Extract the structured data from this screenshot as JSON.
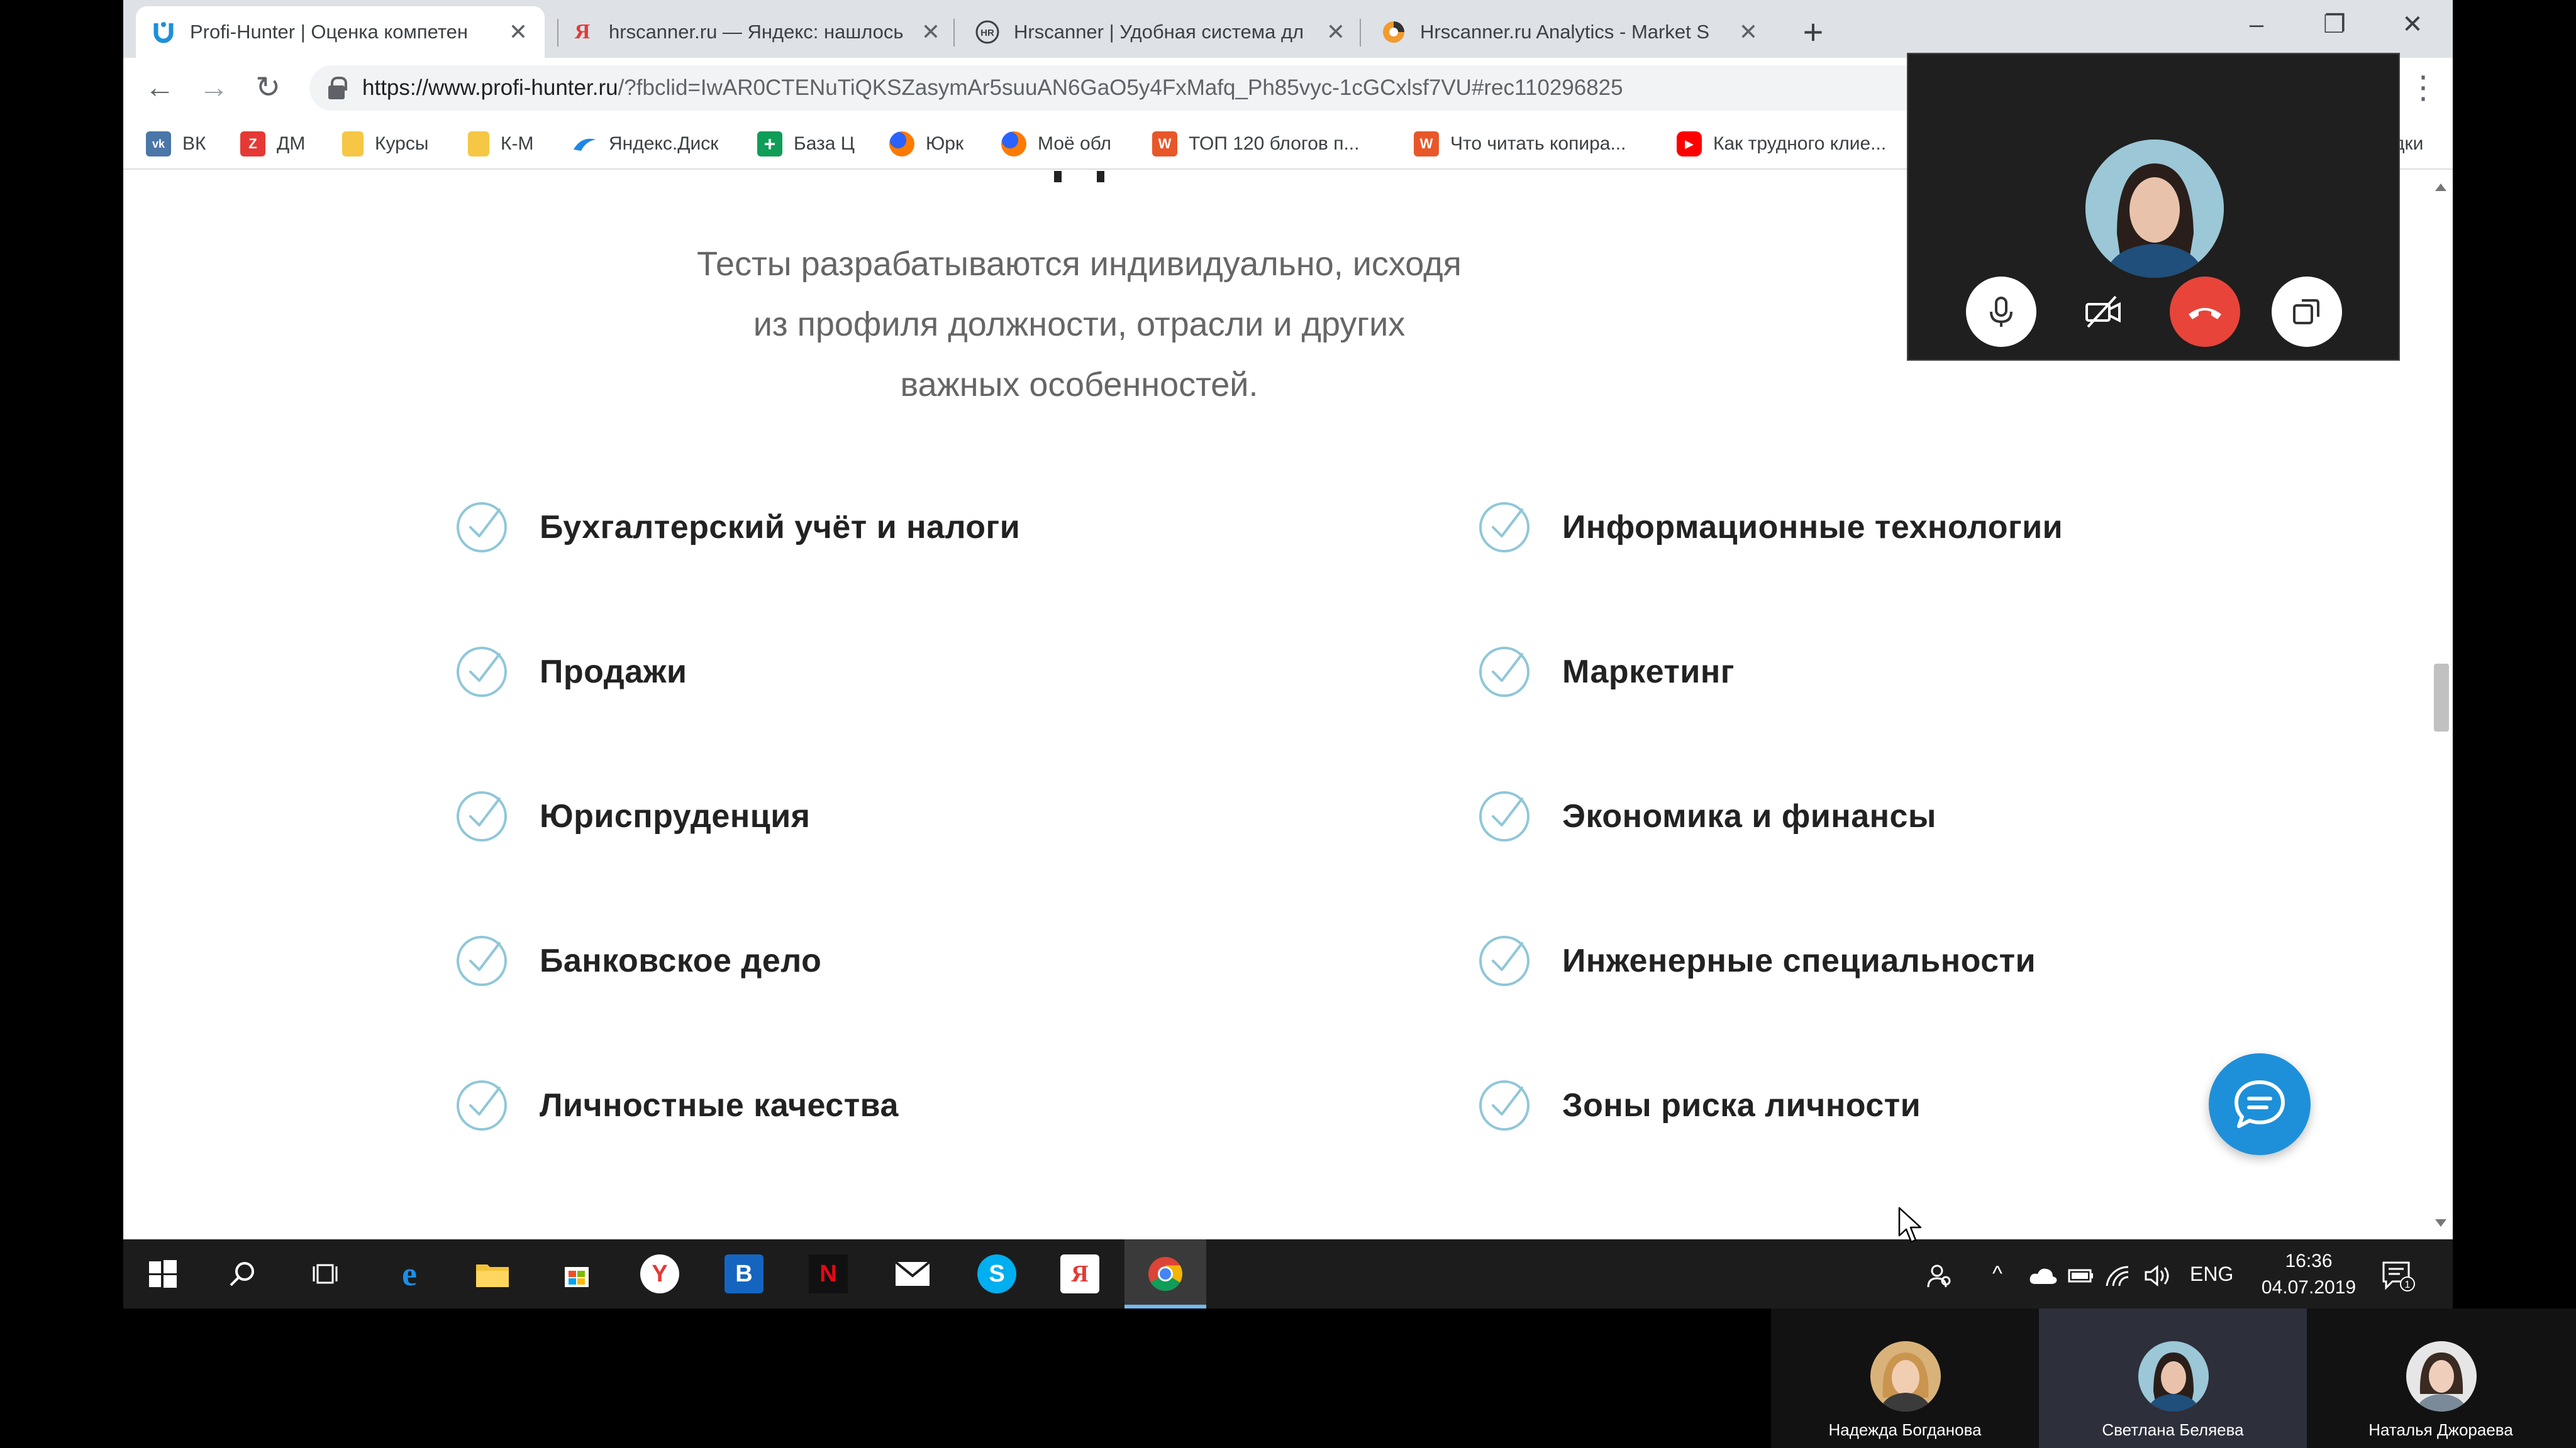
{
  "browser": {
    "tabs": [
      {
        "title": "Profi-Hunter | Оценка компетен",
        "favicon": "profi-hunter-logo",
        "active": true
      },
      {
        "title": "hrscanner.ru — Яндекс: нашлось",
        "favicon": "yandex-logo",
        "active": false
      },
      {
        "title": "Hrscanner | Удобная система дл",
        "favicon": "hr-logo",
        "active": false
      },
      {
        "title": "Hrscanner.ru Analytics - Market S",
        "favicon": "analytics-logo",
        "active": false
      }
    ],
    "tab_close_glyph": "✕",
    "new_tab_glyph": "+",
    "url_host": "https://www.profi-hunter.ru",
    "url_path": "/?fbclid=IwAR0CTENuTiQKSZasymAr5suuAN6GaO5y4FxMafq_Ph85vyc-1cGCxlsf7VU#rec110296825",
    "bookmarks": [
      {
        "label": "ВК",
        "icon": "vk-icon",
        "color": "#4a76a8",
        "glyph": "vk"
      },
      {
        "label": "ДМ",
        "icon": "dm-icon",
        "color": "#e53935",
        "glyph": "Z"
      },
      {
        "label": "Курсы",
        "icon": "folder-icon",
        "color": "#f6c744",
        "glyph": ""
      },
      {
        "label": "К-М",
        "icon": "folder-icon",
        "color": "#f6c744",
        "glyph": ""
      },
      {
        "label": "Яндекс.Диск",
        "icon": "yandex-disk-icon",
        "color": "#1e88e5",
        "glyph": ""
      },
      {
        "label": "База Ц",
        "icon": "sheets-icon",
        "color": "#0f9d58",
        "glyph": "+"
      },
      {
        "label": "Юрк",
        "icon": "firefox-like-icon",
        "color": "#ff7a00",
        "glyph": ""
      },
      {
        "label": "Моё обл",
        "icon": "firefox-like-icon",
        "color": "#ff7a00",
        "glyph": ""
      },
      {
        "label": "ТОП 120 блогов п...",
        "icon": "w-icon",
        "color": "#e8572a",
        "glyph": "W"
      },
      {
        "label": "Что читать копира...",
        "icon": "w-icon",
        "color": "#e8572a",
        "glyph": "W"
      },
      {
        "label": "Как трудного клие...",
        "icon": "youtube-icon",
        "color": "#ff0000",
        "glyph": "▶"
      }
    ],
    "bookmarks_overflow": "дки"
  },
  "page": {
    "subtitle": "Тесты разрабатываются индивидуально, исходя из профиля должности, отрасли и других важных особенностей.",
    "left_items": [
      "Бухгалтерский учёт и налоги",
      "Продажи",
      "Юриспруденция",
      "Банковское дело",
      "Личностные качества"
    ],
    "right_items": [
      "Информационные технологии",
      "Маркетинг",
      "Экономика и финансы",
      "Инженерные специальности",
      "Зоны риска личности"
    ],
    "accent_color": "#8fc7d8",
    "chat_color": "#1e90d9"
  },
  "call": {
    "hangup_color": "#e8443a"
  },
  "taskbar": {
    "language": "ENG",
    "time": "16:36",
    "date": "04.07.2019",
    "notification_count": "1"
  },
  "participants": [
    {
      "name": "Надежда Богданова",
      "active": false
    },
    {
      "name": "Светлана Беляева",
      "active": true
    },
    {
      "name": "Наталья Джораева",
      "active": false
    }
  ]
}
